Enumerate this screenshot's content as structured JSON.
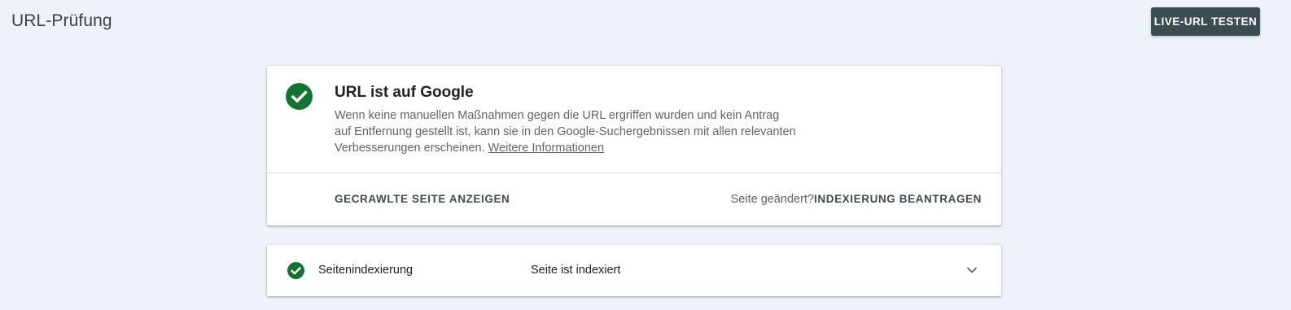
{
  "header": {
    "title": "URL-Prüfung",
    "live_test_label": "LIVE-URL TESTEN"
  },
  "status": {
    "icon": "check-circle-icon",
    "title": "URL ist auf Google",
    "description": "Wenn keine manuellen Maßnahmen gegen die URL ergriffen wurden und kein Antrag auf Entfernung gestellt ist, kann sie in den Google-Suchergebnissen mit allen relevanten Verbesserungen erscheinen.",
    "more_link": "Weitere Informationen",
    "crawled_page_label": "GECRAWLTE SEITE ANZEIGEN",
    "changed_question": "Seite geändert?",
    "request_index_label": "INDEXIERUNG BEANTRAGEN"
  },
  "indexing_row": {
    "icon": "check-circle-icon",
    "label": "Seitenindexierung",
    "value": "Seite ist indexiert",
    "expand_icon": "chevron-down-icon"
  },
  "colors": {
    "background": "#eef3fb",
    "success_green": "#137333",
    "dark_button": "#3c4c55"
  }
}
